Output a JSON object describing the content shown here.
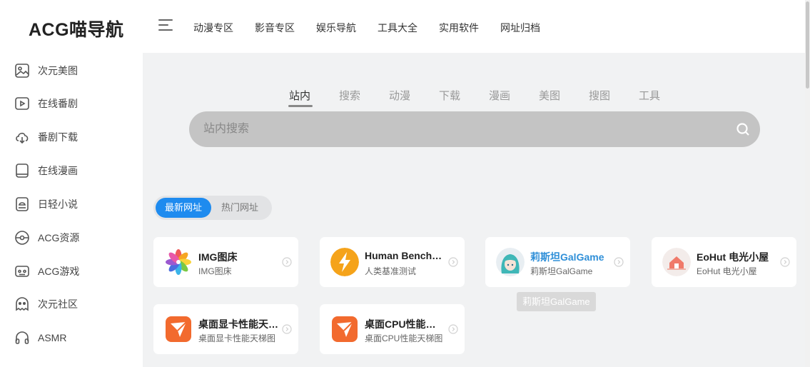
{
  "logo": "ACG喵导航",
  "sidebar": {
    "items": [
      {
        "label": "次元美图",
        "icon": "image-icon"
      },
      {
        "label": "在线番剧",
        "icon": "play-icon"
      },
      {
        "label": "番剧下载",
        "icon": "cloud-download-icon"
      },
      {
        "label": "在线漫画",
        "icon": "book-icon"
      },
      {
        "label": "日轻小说",
        "icon": "novel-icon"
      },
      {
        "label": "ACG资源",
        "icon": "disc-icon"
      },
      {
        "label": "ACG游戏",
        "icon": "gamepad-icon"
      },
      {
        "label": "次元社区",
        "icon": "ghost-icon"
      },
      {
        "label": "ASMR",
        "icon": "headphones-icon"
      }
    ]
  },
  "topnav": {
    "items": [
      "动漫专区",
      "影音专区",
      "娱乐导航",
      "工具大全",
      "实用软件",
      "网址归档"
    ]
  },
  "search": {
    "tabs": [
      "站内",
      "搜索",
      "动漫",
      "下载",
      "漫画",
      "美图",
      "搜图",
      "工具"
    ],
    "active_tab": "站内",
    "placeholder": "站内搜索",
    "value": ""
  },
  "site_tabs": {
    "active": "最新网址",
    "inactive": "热门网址"
  },
  "cards": [
    {
      "title": "IMG图床",
      "subtitle": "IMG图床",
      "icon": "pinwheel-icon"
    },
    {
      "title": "Human Benchmark",
      "subtitle": "人类基准测试",
      "icon": "lightning-icon"
    },
    {
      "title": "莉斯坦GalGame",
      "subtitle": "莉斯坦GalGame",
      "icon": "anime-avatar-icon"
    },
    {
      "title": "EoHut 电光小屋",
      "subtitle": "EoHut 电光小屋",
      "icon": "house-icon"
    },
    {
      "title": "桌面显卡性能天梯图",
      "subtitle": "桌面显卡性能天梯图",
      "icon": "tool-logo-icon"
    },
    {
      "title": "桌面CPU性能天梯图",
      "subtitle": "桌面CPU性能天梯图",
      "icon": "tool-logo-icon"
    }
  ],
  "tooltip": "莉斯坦GalGame",
  "colors": {
    "accent": "#1e8bef",
    "sidebar_bg": "#ffffff",
    "page_bg": "#f1f2f3",
    "search_bg": "#c4c4c4",
    "highlight_title": "#2f8fd8"
  }
}
